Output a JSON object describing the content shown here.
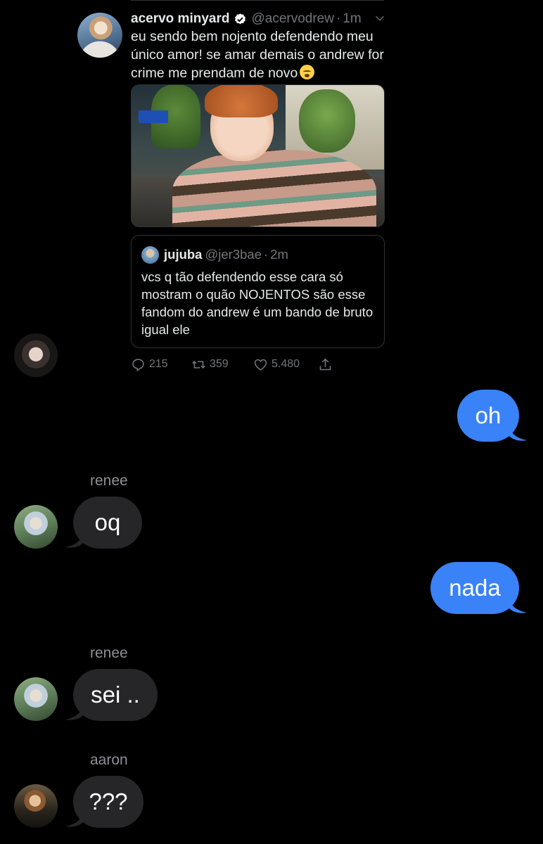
{
  "tweet": {
    "display_name": "acervo minyard",
    "handle": "@acervodrew",
    "separator": "·",
    "time": "1m",
    "text": "eu sendo bem nojento defendendo meu único amor! se amar demais o andrew for crime me prendam de novo",
    "emoji": "flushed-face-emoji",
    "media_description": "photo",
    "quote": {
      "display_name": "jujuba",
      "handle": "@jer3bae",
      "separator": "·",
      "time": "2m",
      "text": "vcs q tão defendendo esse cara só mostram o quão NOJENTOS são esse fandom do andrew é um bando de bruto igual ele"
    },
    "actions": {
      "replies": "215",
      "retweets": "359",
      "likes": "5.480"
    }
  },
  "messages": [
    {
      "side": "outgoing",
      "text": "oh"
    },
    {
      "side": "incoming",
      "sender": "renee",
      "text": "oq"
    },
    {
      "side": "outgoing",
      "text": "nada"
    },
    {
      "side": "incoming",
      "sender": "renee",
      "text": "sei .."
    },
    {
      "side": "incoming",
      "sender": "aaron",
      "text": "???"
    }
  ],
  "colors": {
    "background": "#000000",
    "outgoing_bubble": "#3a82f7",
    "incoming_bubble": "#262628",
    "verified_badge": "#ffffff",
    "secondary_text": "#71767b"
  }
}
